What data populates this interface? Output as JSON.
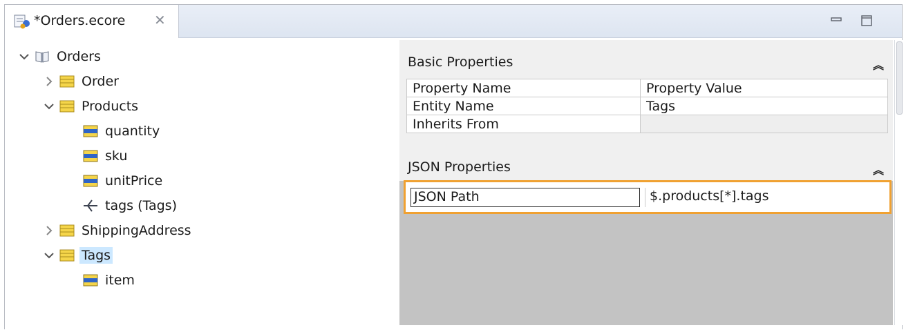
{
  "editor": {
    "tab_title": "*Orders.ecore",
    "tab_close_glyph": "✕"
  },
  "tree": {
    "root": {
      "label": "Orders",
      "expanded": true
    },
    "items": [
      {
        "label": "Order",
        "kind": "class",
        "expanded": false
      },
      {
        "label": "Products",
        "kind": "class",
        "expanded": true
      },
      {
        "label": "quantity",
        "kind": "attribute"
      },
      {
        "label": "sku",
        "kind": "attribute"
      },
      {
        "label": "unitPrice",
        "kind": "attribute"
      },
      {
        "label": "tags (Tags)",
        "kind": "reference"
      },
      {
        "label": "ShippingAddress",
        "kind": "class",
        "expanded": false
      },
      {
        "label": "Tags",
        "kind": "class",
        "expanded": true,
        "selected": true
      },
      {
        "label": "item",
        "kind": "attribute"
      }
    ]
  },
  "properties": {
    "basic_title": "Basic Properties",
    "json_title": "JSON Properties",
    "header": {
      "name": "Property Name",
      "value": "Property Value"
    },
    "rows": [
      {
        "name": "Entity Name",
        "value": "Tags"
      },
      {
        "name": "Inherits From",
        "value": ""
      }
    ],
    "json_row": {
      "name": "JSON Path",
      "value": "$.products[*].tags"
    }
  },
  "colors": {
    "selection": "#cce8ff",
    "highlight_border": "#f0a131",
    "class_icon": "#f5d54a",
    "attribute_icon": "#2e64c8"
  }
}
